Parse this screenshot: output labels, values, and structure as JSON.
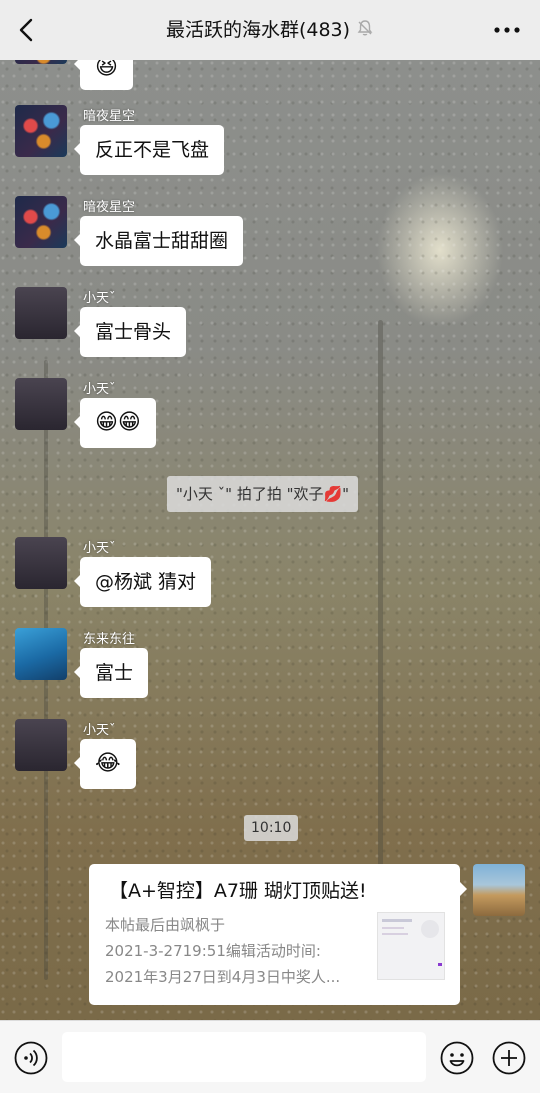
{
  "header": {
    "title": "最活跃的海水群(483)"
  },
  "messages": [
    {
      "sender": "暗夜星空",
      "text": "反正不是飞盘"
    },
    {
      "sender": "暗夜星空",
      "text": "水晶富士甜甜圈"
    },
    {
      "sender": "小天ˇ",
      "text": "富士骨头"
    },
    {
      "sender": "小天ˇ",
      "text": "😁😁"
    },
    {
      "sender": "小天ˇ",
      "text": "@杨斌  猜对"
    },
    {
      "sender": "东来东往",
      "text": "富士"
    },
    {
      "sender": "小天ˇ",
      "text": "😂"
    }
  ],
  "partial_top_emoji": "😆",
  "system_notice": "\"小天 ˇ\" 拍了拍 \"欢子💋\"",
  "timestamp": "10:10",
  "share_card": {
    "title": "【A+智控】A7珊 瑚灯顶贴送!",
    "desc_lines": [
      "本帖最后由飒枫于",
      "2021-3-2719:51编辑活动时间:",
      "2021年3月27日到4月3日中奖人..."
    ]
  },
  "colors": {
    "header_bg": "#ededed",
    "bubble_bg": "#ffffff",
    "bottom_bar_bg": "#f6f6f6"
  }
}
